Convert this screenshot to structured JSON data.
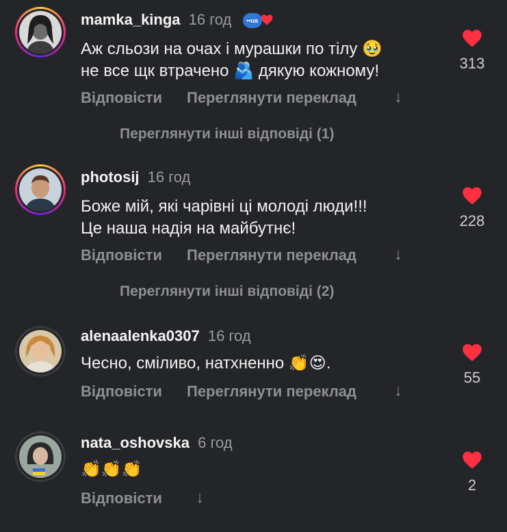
{
  "comments": [
    {
      "username": "mamka_kinga",
      "time": "16 год",
      "text_lines": [
        "Аж сльози на очах і мурашки по тілу 🥹",
        "не все щк втрачено 🫂 дякую кожному!"
      ],
      "actions": {
        "reply": "Відповісти",
        "translate": "Переглянути переклад",
        "arrow": "↓"
      },
      "likes": "313",
      "more_replies": "Переглянути інші відповіді (1)",
      "badge_text": "••ua"
    },
    {
      "username": "photosij",
      "time": "16 год",
      "text_lines": [
        "Боже мій, які чарівні ці молоді люди!!!",
        "Це наша надія на майбутнє!"
      ],
      "actions": {
        "reply": "Відповісти",
        "translate": "Переглянути переклад",
        "arrow": "↓"
      },
      "likes": "228",
      "more_replies": "Переглянути інші відповіді (2)"
    },
    {
      "username": "alenaalenka0307",
      "time": "16 год",
      "text_lines": [
        "Чесно, сміливо, натхненно 👏😍."
      ],
      "actions": {
        "reply": "Відповісти",
        "translate": "Переглянути переклад",
        "arrow": "↓"
      },
      "likes": "55"
    },
    {
      "username": "nata_oshovska",
      "time": "6 год",
      "text_lines": [
        "👏👏👏"
      ],
      "actions": {
        "reply": "Відповісти",
        "arrow": "↓"
      },
      "likes": "2"
    }
  ],
  "colors": {
    "background": "#242528",
    "heart": "#ff3040",
    "muted": "#8e8f94",
    "badge": "#2f78d8"
  }
}
